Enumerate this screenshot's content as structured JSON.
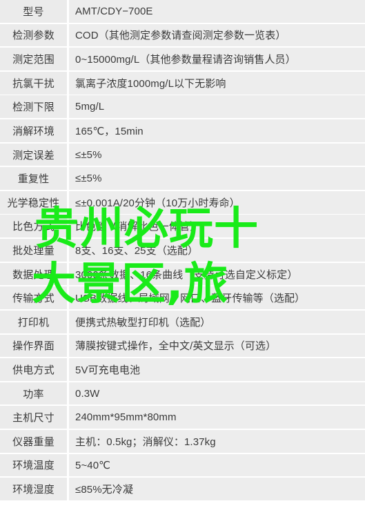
{
  "spec_table": {
    "rows": [
      {
        "label": "型号",
        "value": "AMT/CDY−700E"
      },
      {
        "label": "检测参数",
        "value": "COD（其他测定参数请查阅测定参数一览表）"
      },
      {
        "label": "测定范围",
        "value": "0~15000mg/L（其他参数量程请咨询销售人员）"
      },
      {
        "label": "抗氯干扰",
        "value": "氯离子浓度1000mg/L以下无影响"
      },
      {
        "label": "检测下限",
        "value": "5mg/L"
      },
      {
        "label": "消解环境",
        "value": "165℃，15min"
      },
      {
        "label": "测定误差",
        "value": "≤±5%"
      },
      {
        "label": "重复性",
        "value": "≤±5%"
      },
      {
        "label": "光学稳定性",
        "value": "≤±0.001A/20分钟（10万小时寿命）"
      },
      {
        "label": "比色方式",
        "value": "比色管（消解比色一体管）"
      },
      {
        "label": "批处理量",
        "value": "8支、16支、25支（选配）"
      },
      {
        "label": "数据处理",
        "value": "3000条数据、16条曲线（支持可选自定义标定）"
      },
      {
        "label": "传输方式",
        "value": "USB数据线、局域网、网口、蓝牙传输等（选配）"
      },
      {
        "label": "打印机",
        "value": "便携式热敏型打印机（选配）"
      },
      {
        "label": "操作界面",
        "value": "薄膜按键式操作，全中文/英文显示（可选）"
      },
      {
        "label": "供电方式",
        "value": "5V可充电电池"
      },
      {
        "label": "功率",
        "value": "0.3W"
      },
      {
        "label": "主机尺寸",
        "value": "240mm*95mm*80mm"
      },
      {
        "label": "仪器重量",
        "value": "主机：0.5kg；消解仪：1.37kg"
      },
      {
        "label": "环境温度",
        "value": "5~40℃"
      },
      {
        "label": "环境湿度",
        "value": "≤85%无冷凝"
      }
    ]
  },
  "watermark": {
    "line1": "贵州必玩十",
    "line2": "大景区,旅",
    "color": "#19eb19"
  }
}
